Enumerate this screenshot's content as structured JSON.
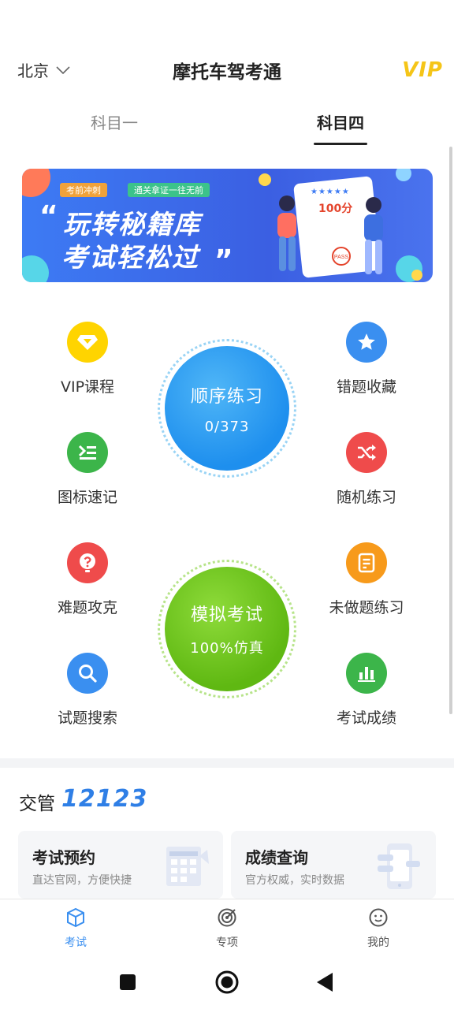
{
  "header": {
    "city": "北京",
    "title": "摩托车驾考通",
    "vip_badge": "VIP"
  },
  "tabs": [
    {
      "label": "科目一"
    },
    {
      "label": "科目四",
      "selected": true
    }
  ],
  "banner": {
    "tag_a": "考前冲刺",
    "tag_b": "通关拿证一往无前",
    "line1": "玩转秘籍库",
    "line2": "考试轻松过",
    "score": "100分",
    "stamp": "PASS"
  },
  "features_left": [
    {
      "label": "VIP课程",
      "icon": "diamond-icon",
      "color": "#ffd400"
    },
    {
      "label": "图标速记",
      "icon": "list-icon",
      "color": "#3cb54a"
    },
    {
      "label": "难题攻克",
      "icon": "question-icon",
      "color": "#ef4b4b"
    },
    {
      "label": "试题搜索",
      "icon": "search-icon",
      "color": "#3a8ff0"
    }
  ],
  "features_right": [
    {
      "label": "错题收藏",
      "icon": "star-icon",
      "color": "#3a8ff0"
    },
    {
      "label": "随机练习",
      "icon": "shuffle-icon",
      "color": "#ef4b4b"
    },
    {
      "label": "未做题练习",
      "icon": "document-icon",
      "color": "#f79a1b"
    },
    {
      "label": "考试成绩",
      "icon": "bar-chart-icon",
      "color": "#3cb54a"
    }
  ],
  "order_practice": {
    "title": "顺序练习",
    "progress": "0/373",
    "color": "#1e90ef"
  },
  "mock_exam": {
    "title": "模拟考试",
    "subtitle": "100%仿真",
    "color": "#6cc31c"
  },
  "jiaoguan": {
    "label": "交管",
    "number": "12123"
  },
  "cards": [
    {
      "title": "考试预约",
      "subtitle": "直达官网，方便快捷"
    },
    {
      "title": "成绩查询",
      "subtitle": "官方权威，实时数据"
    }
  ],
  "bottom_nav": [
    {
      "label": "考试",
      "active": true
    },
    {
      "label": "专项"
    },
    {
      "label": "我的"
    }
  ],
  "colors": {
    "accent": "#2f8ff0",
    "vip": "#f5c518"
  }
}
